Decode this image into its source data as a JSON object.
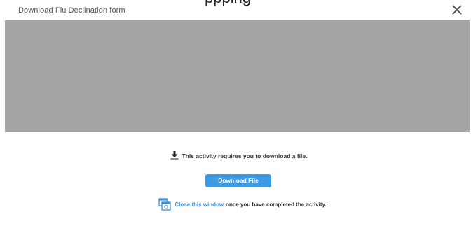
{
  "modal": {
    "title": "Download Flu Declination form",
    "peek_text": "ppping",
    "close_icon": "close-icon"
  },
  "content": {
    "requirement_text": "This activity requires you to download a file.",
    "download_icon": "download-icon",
    "download_button_label": "Download File",
    "window_icon": "window-icon",
    "close_window_link": "Close this window",
    "close_window_suffix": "once you have completed the activity."
  },
  "colors": {
    "accent": "#3a9ae3",
    "link": "#3a8fd6",
    "preview_bg": "#a5a5a5",
    "title_text": "#555555"
  }
}
